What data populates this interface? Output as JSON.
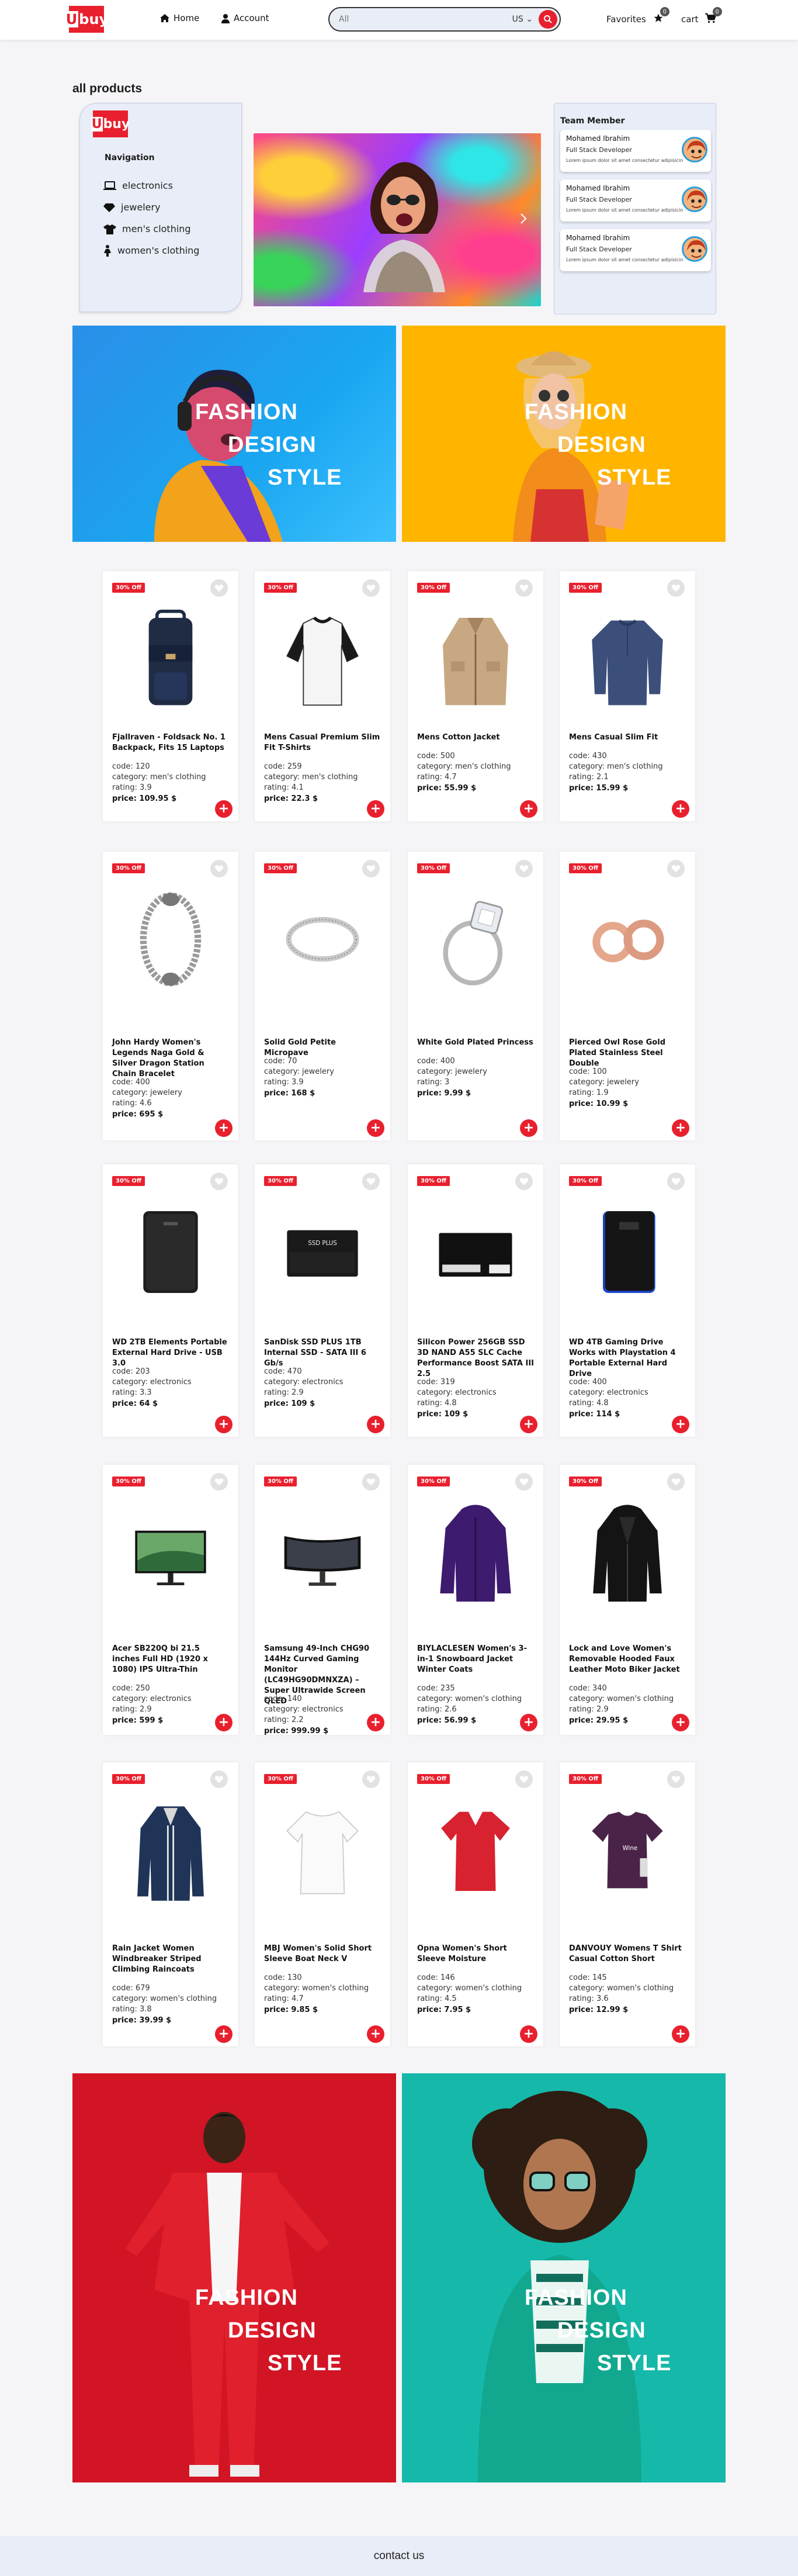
{
  "header": {
    "logo_u": "U",
    "logo_rest": "buy",
    "home_label": "Home",
    "account_label": "Account",
    "search_placeholder": "All",
    "currency": "US",
    "favorites_label": "Favorites",
    "favorites_count": "0",
    "cart_label": "cart",
    "cart_count": "0"
  },
  "section_title": "all products",
  "sidebar": {
    "logo_u": "U",
    "logo_rest": "buy",
    "heading": "Navigation",
    "items": [
      {
        "label": "electronics",
        "icon": "laptop-icon"
      },
      {
        "label": "jewelery",
        "icon": "gem-icon"
      },
      {
        "label": "men's clothing",
        "icon": "shirt-icon"
      },
      {
        "label": "women's clothing",
        "icon": "person-dress-icon"
      }
    ]
  },
  "team": {
    "heading": "Team Member",
    "members": [
      {
        "name": "Mohamed Ibrahim",
        "role": "Full Stack Developer",
        "desc": "Lorem ipsum dolor sit amet consectetur adipisicing elit."
      },
      {
        "name": "Mohamed Ibrahim",
        "role": "Full Stack Developer",
        "desc": "Lorem ipsum dolor sit amet consectetur adipisicing elit."
      },
      {
        "name": "Mohamed Ibrahim",
        "role": "Full Stack Developer",
        "desc": "Lorem ipsum dolor sit amet consectetur adipisicing elit."
      }
    ]
  },
  "banner_text": [
    "FASHION",
    "DESIGN",
    "STYLE"
  ],
  "colors": {
    "accent": "#e8202e",
    "banner_blue": "#1aa6f0",
    "banner_yellow": "#ffb400",
    "banner_red": "#d11525",
    "banner_teal": "#16b8a9"
  },
  "labels": {
    "discount": "30% Off",
    "code": "code:",
    "category": "category:",
    "rating": "rating:",
    "price": "price:",
    "currency_suffix": "$",
    "add": "+"
  },
  "products": [
    {
      "title": "Fjallraven - Foldsack No. 1 Backpack, Fits 15 Laptops",
      "code": "120",
      "category": "men's clothing",
      "rating": "3.9",
      "price": "109.95",
      "icon": "backpack"
    },
    {
      "title": "Mens Casual Premium Slim Fit T-Shirts",
      "code": "259",
      "category": "men's clothing",
      "rating": "4.1",
      "price": "22.3",
      "icon": "tshirt"
    },
    {
      "title": "Mens Cotton Jacket",
      "code": "500",
      "category": "men's clothing",
      "rating": "4.7",
      "price": "55.99",
      "icon": "jacket"
    },
    {
      "title": "Mens Casual Slim Fit",
      "code": "430",
      "category": "men's clothing",
      "rating": "2.1",
      "price": "15.99",
      "icon": "sweater"
    },
    {
      "title": "John Hardy Women's Legends Naga Gold & Silver Dragon Station Chain Bracelet",
      "code": "400",
      "category": "jewelery",
      "rating": "4.6",
      "price": "695",
      "icon": "bracelet"
    },
    {
      "title": "Solid Gold Petite Micropave",
      "code": "70",
      "category": "jewelery",
      "rating": "3.9",
      "price": "168",
      "icon": "ring"
    },
    {
      "title": "White Gold Plated Princess",
      "code": "400",
      "category": "jewelery",
      "rating": "3",
      "price": "9.99",
      "icon": "diamond-ring"
    },
    {
      "title": "Pierced Owl Rose Gold Plated Stainless Steel Double",
      "code": "100",
      "category": "jewelery",
      "rating": "1.9",
      "price": "10.99",
      "icon": "earrings"
    },
    {
      "title": "WD 2TB Elements Portable External Hard Drive - USB 3.0",
      "code": "203",
      "category": "electronics",
      "rating": "3.3",
      "price": "64",
      "icon": "hdd-black"
    },
    {
      "title": "SanDisk SSD PLUS 1TB Internal SSD - SATA III 6 Gb/s",
      "code": "470",
      "category": "electronics",
      "rating": "2.9",
      "price": "109",
      "icon": "ssd-sandisk"
    },
    {
      "title": "Silicon Power 256GB SSD 3D NAND A55 SLC Cache Performance Boost SATA III 2.5",
      "code": "319",
      "category": "electronics",
      "rating": "4.8",
      "price": "109",
      "icon": "ssd-sp"
    },
    {
      "title": "WD 4TB Gaming Drive Works with Playstation 4 Portable External Hard Drive",
      "code": "400",
      "category": "electronics",
      "rating": "4.8",
      "price": "114",
      "icon": "hdd-blue"
    },
    {
      "title": "Acer SB220Q bi 21.5 inches Full HD (1920 x 1080) IPS Ultra-Thin",
      "code": "250",
      "category": "electronics",
      "rating": "2.9",
      "price": "599",
      "icon": "monitor"
    },
    {
      "title": "Samsung 49-Inch CHG90 144Hz Curved Gaming Monitor (LC49HG90DMNXZA) – Super Ultrawide Screen QLED",
      "code": "140",
      "category": "electronics",
      "rating": "2.2",
      "price": "999.99",
      "icon": "curved-monitor"
    },
    {
      "title": "BIYLACLESEN Women's 3-in-1 Snowboard Jacket Winter Coats",
      "code": "235",
      "category": "women's clothing",
      "rating": "2.6",
      "price": "56.99",
      "icon": "purple-jacket"
    },
    {
      "title": "Lock and Love Women's Removable Hooded Faux Leather Moto Biker Jacket",
      "code": "340",
      "category": "women's clothing",
      "rating": "2.9",
      "price": "29.95",
      "icon": "leather-jacket"
    },
    {
      "title": "Rain Jacket Women Windbreaker Striped Climbing Raincoats",
      "code": "679",
      "category": "women's clothing",
      "rating": "3.8",
      "price": "39.99",
      "icon": "raincoat"
    },
    {
      "title": "MBJ Women's Solid Short Sleeve Boat Neck V",
      "code": "130",
      "category": "women's clothing",
      "rating": "4.7",
      "price": "9.85",
      "icon": "white-top"
    },
    {
      "title": "Opna Women's Short Sleeve Moisture",
      "code": "146",
      "category": "women's clothing",
      "rating": "4.5",
      "price": "7.95",
      "icon": "red-tee"
    },
    {
      "title": "DANVOUY Womens T Shirt Casual Cotton Short",
      "code": "145",
      "category": "women's clothing",
      "rating": "3.6",
      "price": "12.99",
      "icon": "purple-tee"
    }
  ],
  "footer": {
    "label": "contact us"
  }
}
